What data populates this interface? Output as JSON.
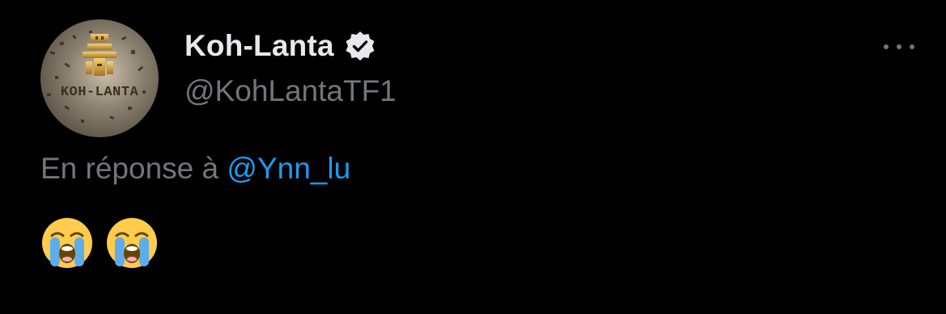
{
  "tweet": {
    "display_name": "Koh-Lanta",
    "handle": "@KohLantaTF1",
    "avatar_text": "KOH-LANTA",
    "reply_prefix": "En réponse à",
    "reply_to": "@Ynn_lu",
    "body": "😭😭",
    "more_icon": "more-horizontal-icon",
    "verified_icon": "verified-badge-icon"
  },
  "colors": {
    "background": "#000000",
    "primary_text": "#e7e9ea",
    "secondary_text": "#71767b",
    "link": "#1d9bf0"
  }
}
